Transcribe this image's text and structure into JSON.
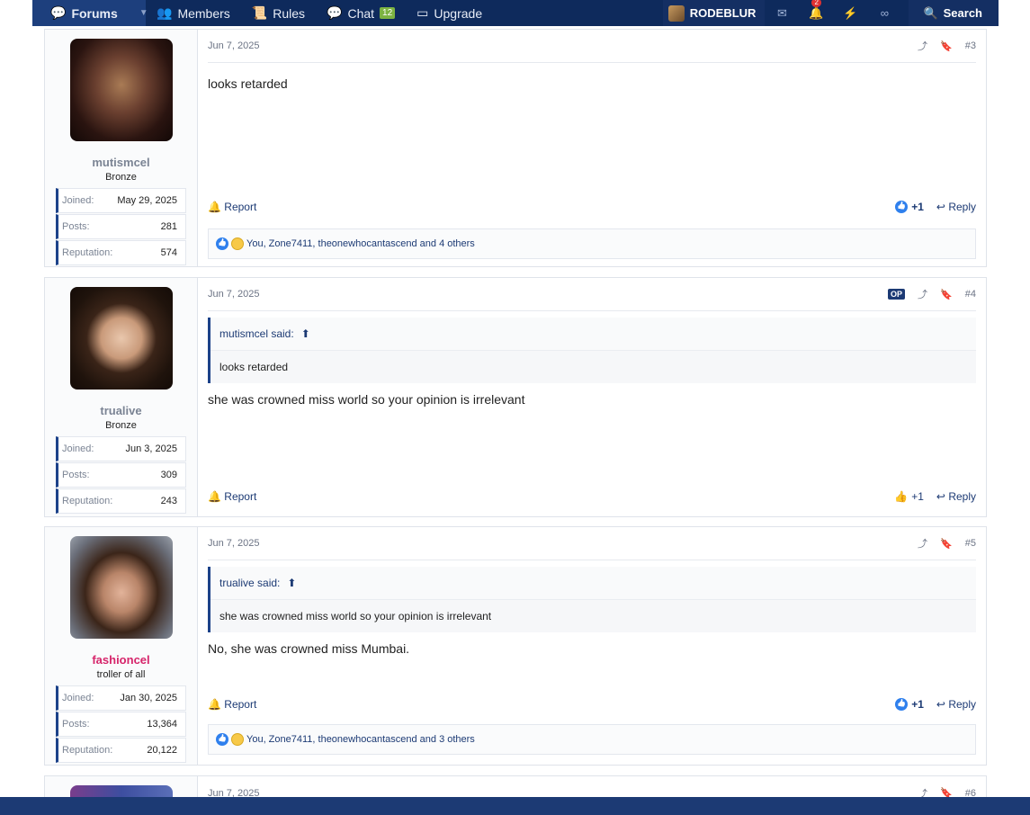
{
  "nav": {
    "forums": "Forums",
    "members": "Members",
    "rules": "Rules",
    "chat": "Chat",
    "chat_badge": "12",
    "upgrade": "Upgrade",
    "username": "RODEBLUR",
    "notifications_count": "2",
    "search": "Search"
  },
  "posts": [
    {
      "date": "Jun 7, 2025",
      "number": "#3",
      "username": "mutismcel",
      "rank": "Bronze",
      "stats": [
        {
          "label": "Joined:",
          "value": "May 29, 2025"
        },
        {
          "label": "Posts:",
          "value": "281"
        },
        {
          "label": "Reputation:",
          "value": "574"
        }
      ],
      "body": "looks retarded",
      "report": "Report",
      "reaction_count": "+1",
      "reply": "Reply",
      "reactions_text": "You, Zone7411, theonewhocantascend and 4 others"
    },
    {
      "date": "Jun 7, 2025",
      "number": "#4",
      "op": "OP",
      "username": "trualive",
      "rank": "Bronze",
      "stats": [
        {
          "label": "Joined:",
          "value": "Jun 3, 2025"
        },
        {
          "label": "Posts:",
          "value": "309"
        },
        {
          "label": "Reputation:",
          "value": "243"
        }
      ],
      "quote_author": "mutismcel said:",
      "quote_text": "looks retarded",
      "body": "she was crowned miss world so your opinion is irrelevant",
      "report": "Report",
      "reaction_count": "+1",
      "reply": "Reply"
    },
    {
      "date": "Jun 7, 2025",
      "number": "#5",
      "username": "fashioncel",
      "rank": "troller of all",
      "stats": [
        {
          "label": "Joined:",
          "value": "Jan 30, 2025"
        },
        {
          "label": "Posts:",
          "value": "13,364"
        },
        {
          "label": "Reputation:",
          "value": "20,122"
        }
      ],
      "quote_author": "trualive said:",
      "quote_text": "she was crowned miss world so your opinion is irrelevant",
      "body": "No, she was crowned miss Mumbai.",
      "report": "Report",
      "reaction_count": "+1",
      "reply": "Reply",
      "reactions_text": "You, Zone7411, theonewhocantascend and 3 others"
    },
    {
      "date": "Jun 7, 2025",
      "number": "#6"
    }
  ],
  "colors": {
    "nav_bg": "#0e2a5c",
    "accent": "#1c4289",
    "username_highlight": "#d6246a"
  }
}
